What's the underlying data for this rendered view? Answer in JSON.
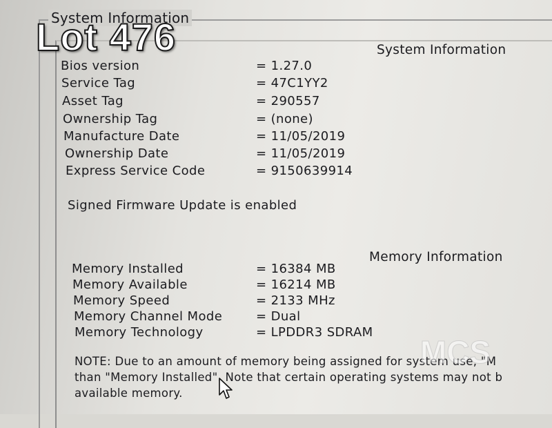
{
  "overlay": {
    "lot_label": "Lot 476",
    "watermark_text": "MCS"
  },
  "group": {
    "title": "System Information"
  },
  "system_info": {
    "heading": "System Information",
    "rows": [
      {
        "label": "Bios version",
        "value": "= 1.27.0"
      },
      {
        "label": "Service Tag",
        "value": "= 47C1YY2"
      },
      {
        "label": "Asset Tag",
        "value": "= 290557"
      },
      {
        "label": "Ownership Tag",
        "value": "= (none)"
      },
      {
        "label": "Manufacture Date",
        "value": "= 11/05/2019"
      },
      {
        "label": "Ownership Date",
        "value": "= 11/05/2019"
      },
      {
        "label": "Express Service Code",
        "value": "= 9150639914"
      }
    ],
    "firmware_status": "Signed Firmware Update is enabled"
  },
  "memory_info": {
    "heading": "Memory Information",
    "rows": [
      {
        "label": "Memory Installed",
        "value": "= 16384 MB"
      },
      {
        "label": "Memory Available",
        "value": "= 16214 MB"
      },
      {
        "label": "Memory Speed",
        "value": "= 2133 MHz"
      },
      {
        "label": "Memory Channel Mode",
        "value": "= Dual"
      },
      {
        "label": "Memory Technology",
        "value": "= LPDDR3 SDRAM"
      }
    ]
  },
  "note": {
    "line1": "NOTE: Due to an amount of memory being assigned for system use, \"M",
    "line2": "than \"Memory Installed\". Note that certain operating systems may not b",
    "line3": "available memory."
  },
  "icons": {
    "cursor": "mouse-pointer-icon"
  }
}
